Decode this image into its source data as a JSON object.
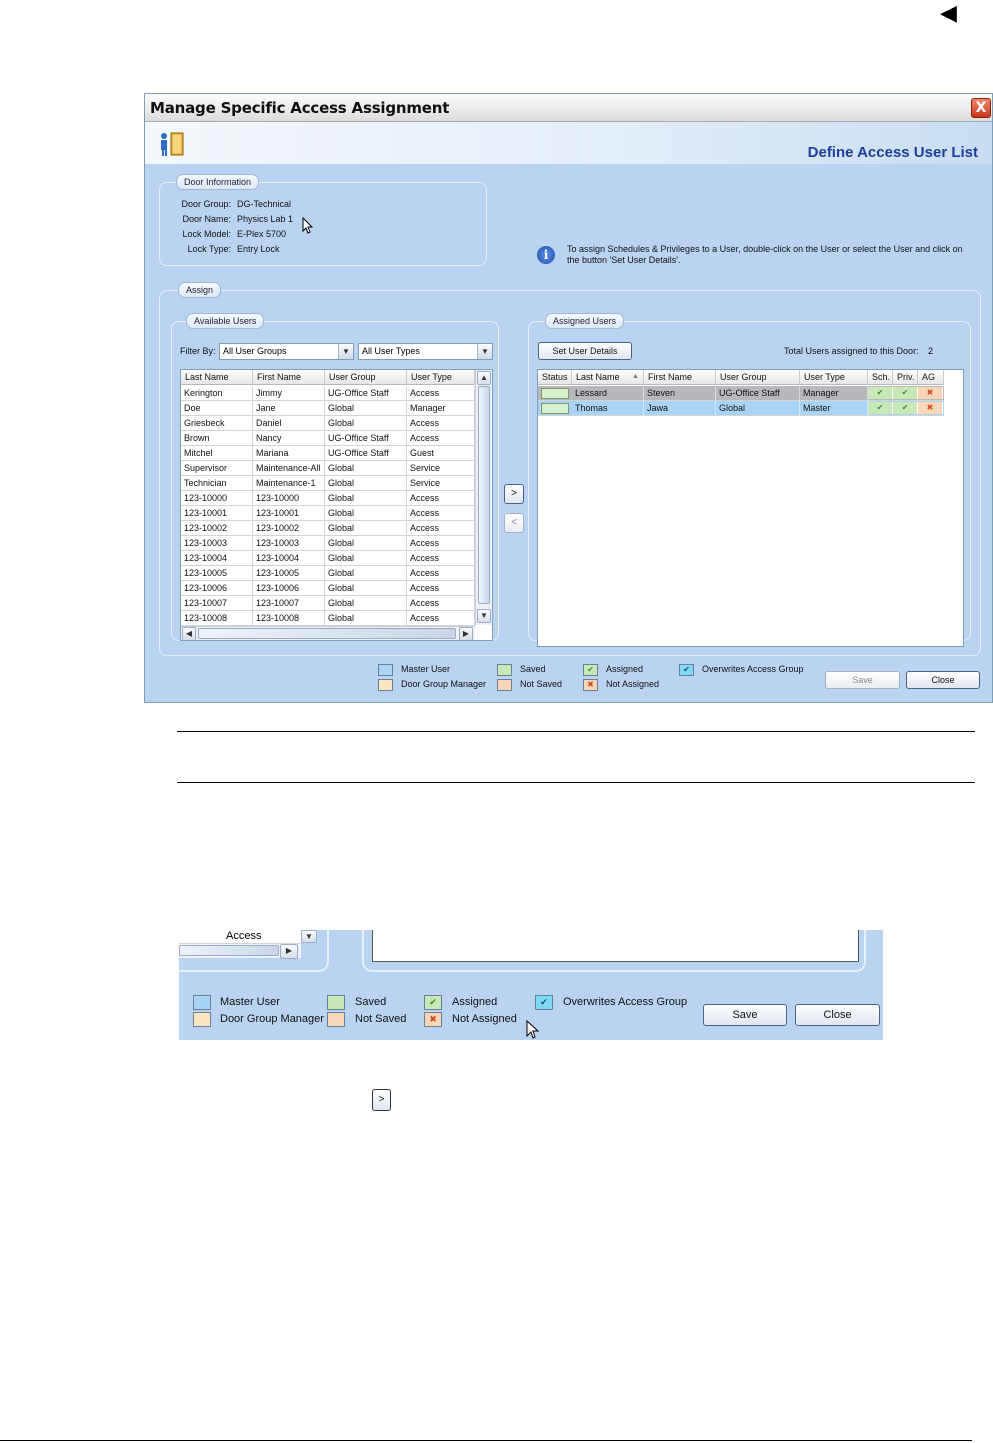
{
  "page": {
    "top_arrow": "◀"
  },
  "dialog": {
    "title": "Manage Specific Access Assignment",
    "header_title": "Define Access User List",
    "close_glyph": "X",
    "door_information": {
      "label": "Door Information",
      "fields": [
        {
          "key": "Door Group:",
          "value": "DG-Technical"
        },
        {
          "key": "Door Name:",
          "value": "Physics Lab 1"
        },
        {
          "key": "Lock Model:",
          "value": "E-Plex 5700"
        },
        {
          "key": "Lock Type:",
          "value": "Entry Lock"
        }
      ]
    },
    "info_text": "To assign Schedules & Privileges to a User, double-click on the User or select the User and click on the button 'Set User Details'.",
    "assign_label": "Assign",
    "available_users": {
      "label": "Available Users",
      "filter_label": "Filter By:",
      "filter_group": "All User Groups",
      "filter_type": "All User Types",
      "columns": [
        "Last Name",
        "First Name",
        "User Group",
        "User Type"
      ],
      "rows": [
        [
          "Kerington",
          "Jimmy",
          "UG-Office Staff",
          "Access"
        ],
        [
          "Doe",
          "Jane",
          "Global",
          "Manager"
        ],
        [
          "Griesbeck",
          "Daniel",
          "Global",
          "Access"
        ],
        [
          "Brown",
          "Nancy",
          "UG-Office Staff",
          "Access"
        ],
        [
          "Mitchel",
          "Mariana",
          "UG-Office Staff",
          "Guest"
        ],
        [
          "Supervisor",
          "Maintenance-All",
          "Global",
          "Service"
        ],
        [
          "Technician",
          "Maintenance-1",
          "Global",
          "Service"
        ],
        [
          "123-10000",
          "123-10000",
          "Global",
          "Access"
        ],
        [
          "123-10001",
          "123-10001",
          "Global",
          "Access"
        ],
        [
          "123-10002",
          "123-10002",
          "Global",
          "Access"
        ],
        [
          "123-10003",
          "123-10003",
          "Global",
          "Access"
        ],
        [
          "123-10004",
          "123-10004",
          "Global",
          "Access"
        ],
        [
          "123-10005",
          "123-10005",
          "Global",
          "Access"
        ],
        [
          "123-10006",
          "123-10006",
          "Global",
          "Access"
        ],
        [
          "123-10007",
          "123-10007",
          "Global",
          "Access"
        ],
        [
          "123-10008",
          "123-10008",
          "Global",
          "Access"
        ]
      ]
    },
    "assigned_users": {
      "label": "Assigned Users",
      "set_details_label": "Set User Details",
      "total_label": "Total Users assigned to this Door:",
      "total_value": "2",
      "columns": [
        "Status",
        "Last Name",
        "First Name",
        "User Group",
        "User Type",
        "Sch.",
        "Priv.",
        "AG"
      ],
      "rows": [
        [
          "",
          "Lessard",
          "Steven",
          "UG-Office Staff",
          "Manager"
        ],
        [
          "",
          "Thomas",
          "Jawa",
          "Global",
          "Master"
        ]
      ]
    },
    "move_right": ">",
    "move_left": "<",
    "legend": {
      "master_user": "Master User",
      "door_group_manager": "Door Group Manager",
      "saved": "Saved",
      "not_saved": "Not Saved",
      "assigned": "Assigned",
      "not_assigned": "Not Assigned",
      "overwrites": "Overwrites Access Group"
    },
    "save_label": "Save",
    "close_label": "Close"
  },
  "crop": {
    "cell_value": "Access",
    "save_label": "Save",
    "close_label": "Close"
  },
  "inline_button": ">",
  "colors": {
    "master_user": "#a9d4f5",
    "door_group_manager": "#fbe7c0",
    "saved": "#c8e8b8",
    "not_saved": "#f8d6b8",
    "overwrites": "#7fd8f5",
    "dialog_bg": "#b9d3f0",
    "header_title": "#1d3f9a"
  }
}
